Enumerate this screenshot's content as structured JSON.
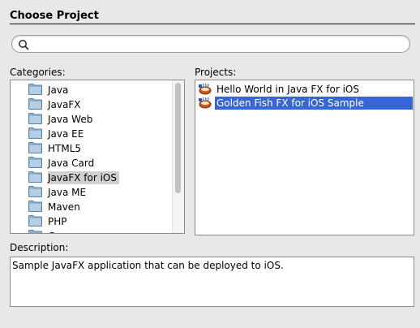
{
  "dialog": {
    "title": "Choose Project"
  },
  "search": {
    "value": "",
    "placeholder": ""
  },
  "categories": {
    "label": "Categories:",
    "items": [
      {
        "label": "Java"
      },
      {
        "label": "JavaFX"
      },
      {
        "label": "Java Web"
      },
      {
        "label": "Java EE"
      },
      {
        "label": "HTML5"
      },
      {
        "label": "Java Card"
      },
      {
        "label": "JavaFX for iOS"
      },
      {
        "label": "Java ME"
      },
      {
        "label": "Maven"
      },
      {
        "label": "PHP"
      },
      {
        "label": "Groovy"
      }
    ],
    "selected_index": 6
  },
  "projects": {
    "label": "Projects:",
    "items": [
      {
        "label": "Hello World in Java FX for iOS",
        "icon": "coffee-cup-project-icon"
      },
      {
        "label": "Golden Fish FX for iOS Sample",
        "icon": "coffee-cup-project-icon"
      }
    ],
    "selected_index": 1
  },
  "description": {
    "label": "Description:",
    "text": "Sample JavaFX application that can be deployed to iOS."
  },
  "colors": {
    "selection_blue": "#3765d8",
    "category_selection": "#d0d0d0",
    "folder_blue": "#9bbcd7"
  }
}
